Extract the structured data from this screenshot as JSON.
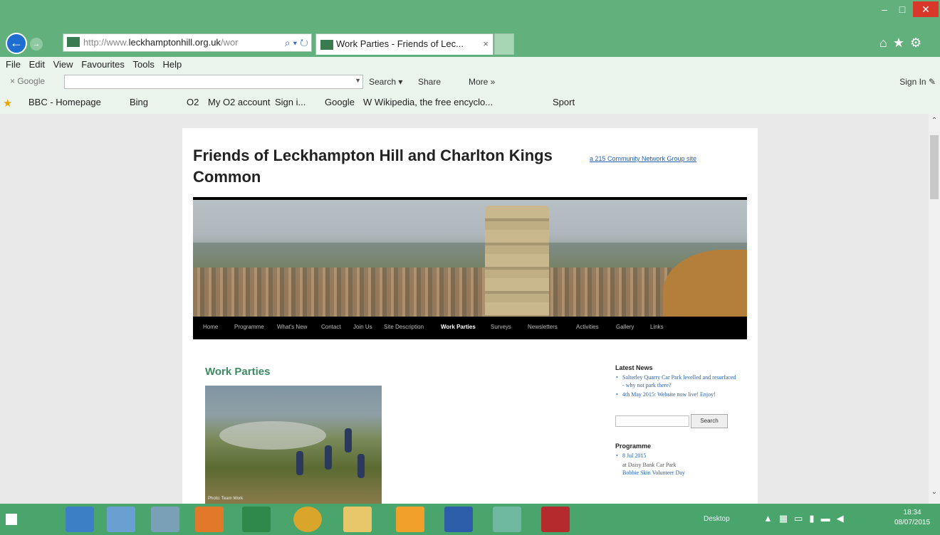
{
  "browser": {
    "address": {
      "prefix": "http://www.",
      "host": "leckhamptonhill.org.uk",
      "suffix": "/wor",
      "tools": "⌕ ▾ ↻"
    },
    "tab_title": "Work Parties - Friends of Lec...",
    "tab_close": "×",
    "window_buttons": {
      "min": "–",
      "max": "□",
      "close": "✕"
    },
    "nav_right_icons": "⌂★⚙"
  },
  "menu": [
    "File",
    "Edit",
    "View",
    "Favourites",
    "Tools",
    "Help"
  ],
  "google_bar": {
    "logo": "× Google",
    "search_label": "Search ▾",
    "share_label": "Share",
    "more_label": "More »",
    "signin_label": "Sign In ✎"
  },
  "favourites": [
    {
      "label": "BBC - Homepage"
    },
    {
      "label": "Bing"
    },
    {
      "label": "O2"
    },
    {
      "label": "My O2 account"
    },
    {
      "label": "Sign i..."
    },
    {
      "label": "Google"
    },
    {
      "label": "W Wikipedia, the free encyclo..."
    },
    {
      "label": "Sport"
    }
  ],
  "site": {
    "title": "Friends of Leckhampton Hill and Charlton Kings Common",
    "network_link": "a 215 Community Network Group site",
    "nav": [
      "Home",
      "Programme",
      "What's New",
      "Contact",
      "Join Us",
      "Site Description",
      "Work Parties",
      "Surveys",
      "Newsletters",
      "Activities",
      "Gallery",
      "Links"
    ],
    "active_nav": "Work Parties",
    "content_title": "Work Parties",
    "photo_caption": "Photo: Team Work"
  },
  "sidebar": {
    "latest_heading": "Latest News",
    "news": [
      "Salterley Quarry Car Park levelled and resurfaced - why not park there?",
      "4th May 2015: Website now live! Enjoy!"
    ],
    "search_button": "Search",
    "programme_heading": "Programme",
    "programme": [
      {
        "date": "8 Jul 2015",
        "detail": "at Daisy Bank Car Park",
        "title": "Bobbie Skin Volunteer Day"
      }
    ]
  },
  "taskbar": {
    "desktop_label": "Desktop",
    "time": "18:34",
    "date": "08/07/2015",
    "apps": [
      "file-explorer",
      "notepad",
      "network",
      "media-player",
      "excel",
      "chrome",
      "folder",
      "outlook",
      "word",
      "internet-explorer",
      "power"
    ]
  },
  "colors": {
    "chrome": "#62b07b",
    "accent": "#3f8a63",
    "link": "#2561b2",
    "taskbar": "#4aa56c"
  }
}
